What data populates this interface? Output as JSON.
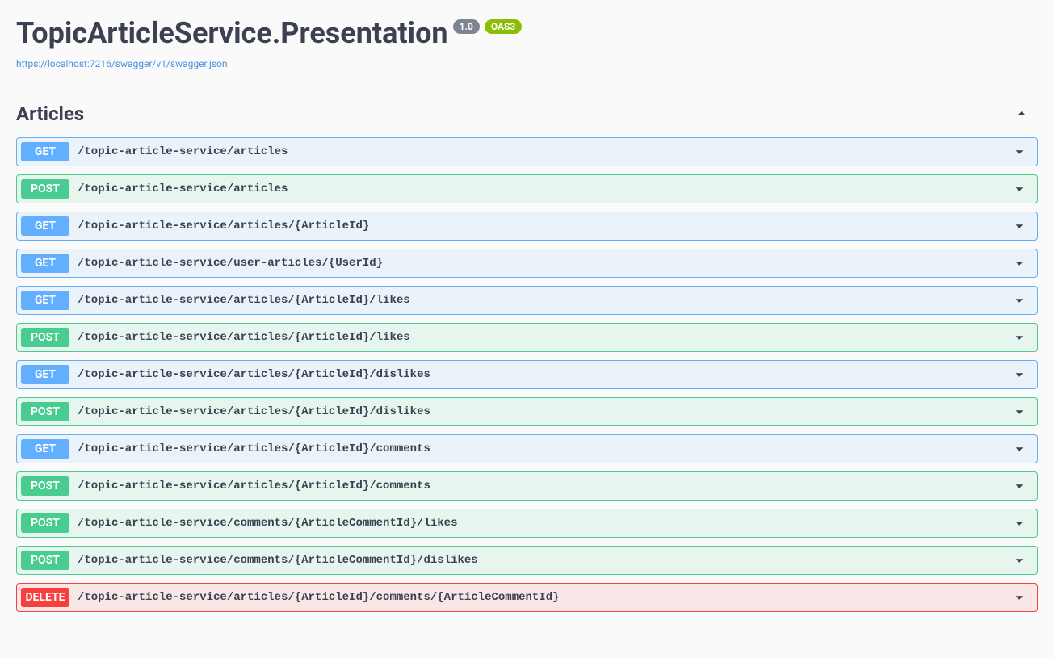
{
  "header": {
    "title": "TopicArticleService.Presentation",
    "version": "1.0",
    "oas_label": "OAS3",
    "spec_url": "https://localhost:7216/swagger/v1/swagger.json"
  },
  "section": {
    "name": "Articles"
  },
  "operations": [
    {
      "method": "GET",
      "path": "/topic-article-service/articles"
    },
    {
      "method": "POST",
      "path": "/topic-article-service/articles"
    },
    {
      "method": "GET",
      "path": "/topic-article-service/articles/{ArticleId}"
    },
    {
      "method": "GET",
      "path": "/topic-article-service/user-articles/{UserId}"
    },
    {
      "method": "GET",
      "path": "/topic-article-service/articles/{ArticleId}/likes"
    },
    {
      "method": "POST",
      "path": "/topic-article-service/articles/{ArticleId}/likes"
    },
    {
      "method": "GET",
      "path": "/topic-article-service/articles/{ArticleId}/dislikes"
    },
    {
      "method": "POST",
      "path": "/topic-article-service/articles/{ArticleId}/dislikes"
    },
    {
      "method": "GET",
      "path": "/topic-article-service/articles/{ArticleId}/comments"
    },
    {
      "method": "POST",
      "path": "/topic-article-service/articles/{ArticleId}/comments"
    },
    {
      "method": "POST",
      "path": "/topic-article-service/comments/{ArticleCommentId}/likes"
    },
    {
      "method": "POST",
      "path": "/topic-article-service/comments/{ArticleCommentId}/dislikes"
    },
    {
      "method": "DELETE",
      "path": "/topic-article-service/articles/{ArticleId}/comments/{ArticleCommentId}"
    }
  ]
}
